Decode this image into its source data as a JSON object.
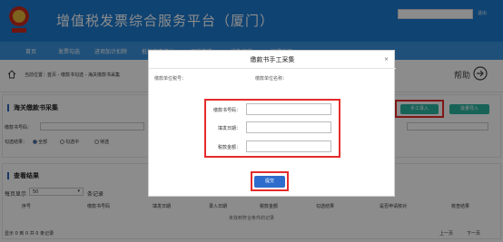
{
  "header": {
    "title": "增值税发票综合服务平台（厦门）",
    "user_link": "退出"
  },
  "nav": {
    "items": [
      "首页",
      "发票勾选",
      "进项加计扣除",
      "抵扣勾选统计",
      "退税勾选",
      "代办退税",
      "扫描认证"
    ]
  },
  "breadcrumb": {
    "text": "当前位置：首页 - 缴款书勾选 - 海关缴款书采集",
    "help_label": "帮助"
  },
  "collect": {
    "title": "海关缴款书采集",
    "field_label": "缴款书号码：",
    "status_label": "勾选结果：",
    "radio_all": "全部",
    "radio_collect": "勾选中",
    "radio_pending": "待选",
    "manual_button": "手工录入",
    "batch_button": "批量导入"
  },
  "results": {
    "title": "查看结果",
    "page_size_label": "每页显示",
    "page_size": "50",
    "records_label": "条记录",
    "columns": [
      "序号",
      "缴款书号码",
      "填发日期",
      "录入日期",
      "税款金额",
      "勾选结果",
      "是否申请核对",
      "核查结果"
    ],
    "empty_text": "未找到符合条件的记录",
    "footer_text": "显示 0 到 0 共 0 条记录",
    "prev": "上一页",
    "next": "下一页"
  },
  "modal": {
    "title": "缴款书手工采集",
    "close": "×",
    "taxpayer_id_label": "缴款单位税号：",
    "taxpayer_name_label": "缴款单位名称：",
    "fields": [
      {
        "label": "缴款书号码：",
        "value": ""
      },
      {
        "label": "填发日期：",
        "value": ""
      },
      {
        "label": "税款金额：",
        "value": ""
      }
    ],
    "submit": "提交"
  },
  "colors": {
    "header": "#1d7ad0",
    "nav": "#3a93dc",
    "accent": "#2bb5a0",
    "primary": "#2d6ccc",
    "highlight": "#e52b2b"
  }
}
